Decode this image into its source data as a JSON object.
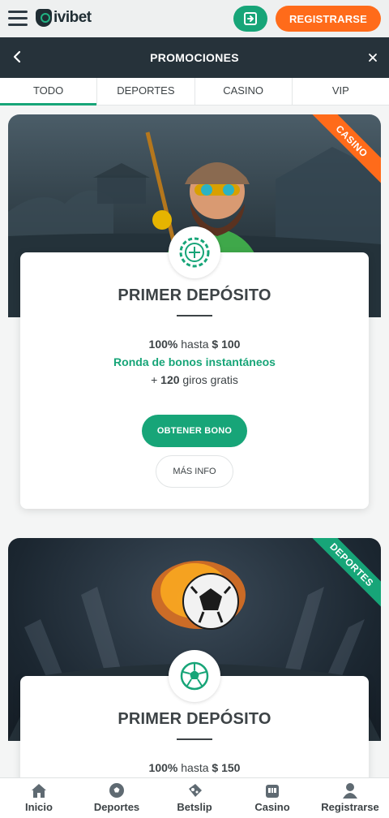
{
  "header": {
    "logo_text": "ivibet",
    "login_icon": "login-icon",
    "register_label": "REGISTRARSE"
  },
  "promo_header": {
    "title": "PROMOCIONES",
    "back_icon": "chevron-left-icon",
    "close_icon": "close-icon"
  },
  "tabs": [
    {
      "label": "TODO",
      "active": true
    },
    {
      "label": "DEPORTES",
      "active": false
    },
    {
      "label": "CASINO",
      "active": false
    },
    {
      "label": "VIP",
      "active": false
    }
  ],
  "promos": [
    {
      "category": "CASINO",
      "badge_icon": "casino-chip-icon",
      "title": "PRIMER DEPÓSITO",
      "line1_pct": "100%",
      "line1_mid": " hasta ",
      "line1_amount": "$ 100",
      "line2": "Ronda de bonos instantáneos",
      "line3_prefix": "+ ",
      "line3_num": "120",
      "line3_suffix": " giros gratis",
      "button_label": "OBTENER BONO",
      "info_label": "MÁS INFO"
    },
    {
      "category": "DEPORTES",
      "badge_icon": "soccer-ball-icon",
      "title": "PRIMER DEPÓSITO",
      "line1_pct": "100%",
      "line1_mid": " hasta ",
      "line1_amount": "$ 150"
    }
  ],
  "bottom_nav": [
    {
      "label": "Inicio",
      "icon": "home-icon"
    },
    {
      "label": "Deportes",
      "icon": "soccer-ball-icon"
    },
    {
      "label": "Betslip",
      "icon": "ticket-icon"
    },
    {
      "label": "Casino",
      "icon": "slot-machine-icon"
    },
    {
      "label": "Registrarse",
      "icon": "user-icon"
    }
  ],
  "colors": {
    "accent_green": "#17a578",
    "accent_orange": "#ff6b1a",
    "header_dark": "#26323a"
  }
}
